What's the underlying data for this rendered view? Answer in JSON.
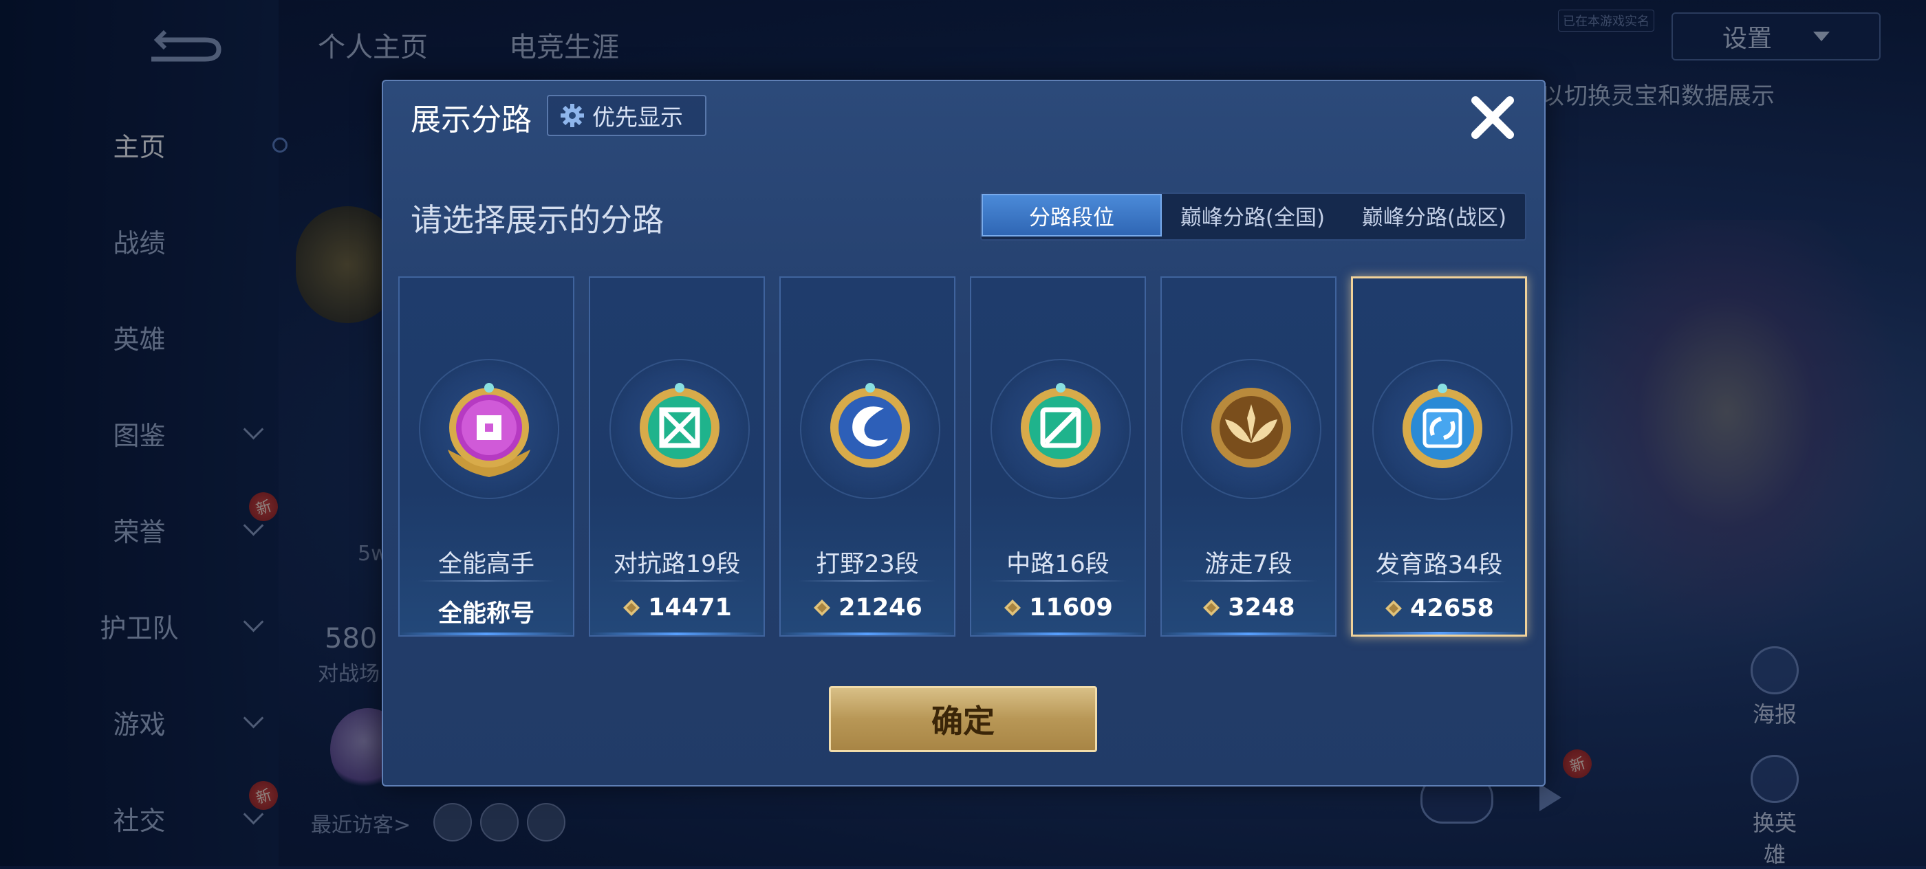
{
  "sidebar": {
    "items": [
      {
        "label": "主页"
      },
      {
        "label": "战绩"
      },
      {
        "label": "英雄"
      },
      {
        "label": "图鉴"
      },
      {
        "label": "荣誉"
      },
      {
        "label": "护卫队"
      },
      {
        "label": "游戏"
      },
      {
        "label": "社交"
      }
    ],
    "new_badge": "新"
  },
  "background": {
    "tabs": [
      "个人主页",
      "电竞生涯"
    ],
    "settings_label": "设置",
    "small_tag": "已在本游戏实名",
    "hint": "以切换灵宝和数据展示",
    "stat_partial": "5w",
    "battle_count": "580",
    "battle_label": "对战场",
    "recent_visitors": "最近访客>",
    "poster_label": "海报",
    "switch_hero_label": "换英雄",
    "new_badge": "新"
  },
  "modal": {
    "title": "展示分路",
    "pref_button": "优先显示",
    "subtitle": "请选择展示的分路",
    "tabs": [
      "分路段位",
      "巅峰分路(全国)",
      "巅峰分路(战区)"
    ],
    "active_tab": 0,
    "cards": [
      {
        "name": "全能高手",
        "value": "全能称号",
        "has_gem": false,
        "badge": "all-round",
        "selected": false
      },
      {
        "name": "对抗路19段",
        "value": "14471",
        "has_gem": true,
        "badge": "clash-lane",
        "selected": false
      },
      {
        "name": "打野23段",
        "value": "21246",
        "has_gem": true,
        "badge": "jungle",
        "selected": false
      },
      {
        "name": "中路16段",
        "value": "11609",
        "has_gem": true,
        "badge": "mid-lane",
        "selected": false
      },
      {
        "name": "游走7段",
        "value": "3248",
        "has_gem": true,
        "badge": "roam",
        "selected": false
      },
      {
        "name": "发育路34段",
        "value": "42658",
        "has_gem": true,
        "badge": "farm-lane",
        "selected": true
      }
    ],
    "confirm_label": "确定"
  },
  "colors": {
    "accent_gold": "#f0d29a",
    "tab_active": "#3f7cd0",
    "modal_bg": "#243f6d"
  }
}
